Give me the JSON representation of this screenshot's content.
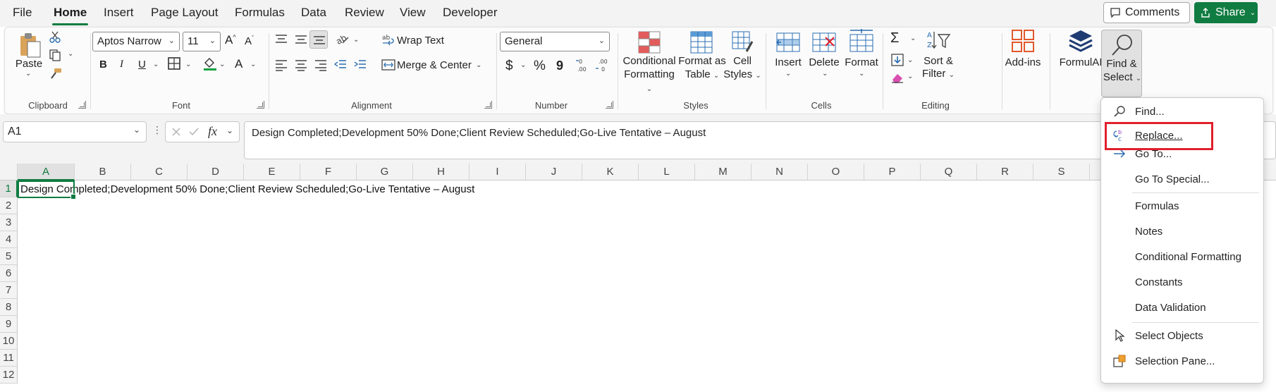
{
  "tabs": [
    "File",
    "Home",
    "Insert",
    "Page Layout",
    "Formulas",
    "Data",
    "Review",
    "View",
    "Developer"
  ],
  "active_tab": "Home",
  "top_buttons": {
    "comments": "Comments",
    "share": "Share"
  },
  "ribbon": {
    "clipboard": {
      "paste": "Paste",
      "label": "Clipboard"
    },
    "font": {
      "font_name": "Aptos Narrow",
      "font_size": "11",
      "bold": "B",
      "italic": "I",
      "underline": "U",
      "label": "Font"
    },
    "alignment": {
      "wrap_text": "Wrap Text",
      "merge_center": "Merge & Center",
      "label": "Alignment"
    },
    "number": {
      "format": "General",
      "currency": "$",
      "percent": "%",
      "comma": "9",
      "label": "Number"
    },
    "styles": {
      "conditional_formatting": [
        "Conditional",
        "Formatting"
      ],
      "format_as_table": [
        "Format as",
        "Table"
      ],
      "cell_styles": [
        "Cell",
        "Styles"
      ],
      "label": "Styles"
    },
    "cells": {
      "insert": "Insert",
      "delete": "Delete",
      "format": "Format",
      "label": "Cells"
    },
    "editing": {
      "sort_filter": [
        "Sort &",
        "Filter"
      ],
      "find_select": [
        "Find &",
        "Select"
      ],
      "label": "Editing"
    },
    "addins": {
      "label": "Add-ins"
    },
    "formulai": {
      "label": "FormulAI"
    }
  },
  "formula_bar": {
    "name_box": "A1",
    "fx": "fx",
    "value": "Design Completed;Development 50% Done;Client Review Scheduled;Go-Live Tentative – August"
  },
  "grid": {
    "columns": [
      "A",
      "B",
      "C",
      "D",
      "E",
      "F",
      "G",
      "H",
      "I",
      "J",
      "K",
      "L",
      "M",
      "N",
      "O",
      "P",
      "Q",
      "R",
      "S"
    ],
    "rows": [
      "1",
      "2",
      "3",
      "4",
      "5",
      "6",
      "7",
      "8",
      "9",
      "10",
      "11",
      "12"
    ],
    "a1_value": "Design Completed;Development 50% Done;Client Review Scheduled;Go-Live Tentative – August"
  },
  "find_select_menu": {
    "items": [
      {
        "label": "Find...",
        "icon": "search-icon"
      },
      {
        "label": "Replace...",
        "icon": "replace-icon"
      },
      {
        "label": "Go To...",
        "icon": "arrow-right-icon"
      },
      {
        "label": "Go To Special...",
        "icon": ""
      },
      {
        "label": "Formulas",
        "icon": ""
      },
      {
        "label": "Notes",
        "icon": ""
      },
      {
        "label": "Conditional Formatting",
        "icon": ""
      },
      {
        "label": "Constants",
        "icon": ""
      },
      {
        "label": "Data Validation",
        "icon": ""
      },
      {
        "label": "Select Objects",
        "icon": "pointer-icon"
      },
      {
        "label": "Selection Pane...",
        "icon": "selection-pane-icon"
      }
    ],
    "highlighted": "Replace..."
  },
  "colors": {
    "accent": "#107c41",
    "highlight_box": "#e0202c"
  }
}
